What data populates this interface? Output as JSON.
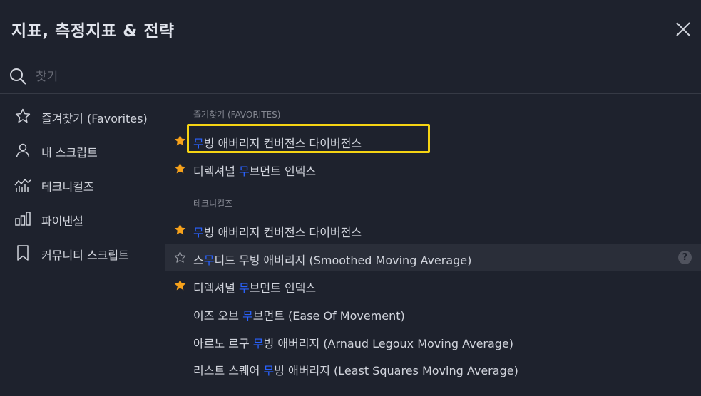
{
  "header": {
    "title": "지표, 측정지표 & 전략",
    "close_icon": "close-icon"
  },
  "search": {
    "placeholder": "찾기",
    "value": ""
  },
  "sidebar": {
    "items": [
      {
        "label": "즐겨찾기 (Favorites)",
        "icon": "star-outline-icon"
      },
      {
        "label": "내 스크립트",
        "icon": "user-icon"
      },
      {
        "label": "테크니컬즈",
        "icon": "technicals-chart-icon"
      },
      {
        "label": "파이낸셜",
        "icon": "bar-chart-icon"
      },
      {
        "label": "커뮤니티 스크립트",
        "icon": "bookmark-icon"
      }
    ]
  },
  "sections": [
    {
      "title": "즐겨찾기 (FAVORITES)",
      "rows": [
        {
          "pre": "",
          "hl": "무",
          "post": "빙 애버리지 컨버전스 다이버전스",
          "star": "filled"
        },
        {
          "pre": "디렉셔널 ",
          "hl": "무",
          "post": "브먼트 인덱스",
          "star": "filled"
        }
      ]
    },
    {
      "title": "테크니컬즈",
      "rows": [
        {
          "pre": "",
          "hl": "무",
          "post": "빙 애버리지 컨버전스 다이버전스",
          "star": "filled"
        },
        {
          "pre": "스",
          "hl": "무",
          "post": "디드 무빙 애버리지 (Smoothed Moving Average)",
          "star": "outline",
          "help": "?"
        },
        {
          "pre": "디렉셔널 ",
          "hl": "무",
          "post": "브먼트 인덱스",
          "star": "filled"
        },
        {
          "pre": "이즈 오브 ",
          "hl": "무",
          "post": "브먼트 (Ease Of Movement)",
          "star": "none"
        },
        {
          "pre": "아르노 르구 ",
          "hl": "무",
          "post": "빙 애버리지 (Arnaud Legoux Moving Average)",
          "star": "none"
        },
        {
          "pre": "리스트 스퀘어 ",
          "hl": "무",
          "post": "빙 애버리지 (Least Squares Moving Average)",
          "star": "none"
        }
      ]
    }
  ],
  "colors": {
    "background": "#1e222d",
    "highlight_text": "#2962ff",
    "star": "#f7a21b",
    "annotation_box": "#f5d313"
  }
}
